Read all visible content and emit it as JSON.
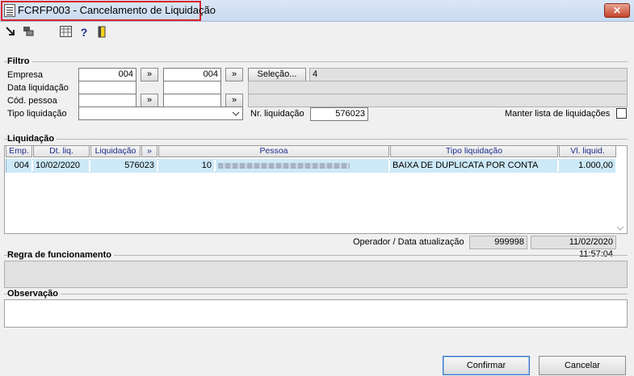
{
  "window": {
    "title": "FCRFP003 - Cancelamento de Liquidação",
    "close_glyph": "✕"
  },
  "toolbar": {
    "icons": [
      "arrow-icon",
      "layers-icon",
      "grid-icon",
      "help-icon",
      "exit-icon"
    ]
  },
  "filtro": {
    "section": "Filtro",
    "empresa_label": "Empresa",
    "empresa_from": "004",
    "empresa_to": "004",
    "selecao_label": "Seleção...",
    "selecao_value": "4",
    "data_label": "Data liquidação",
    "cod_label": "Cód. pessoa",
    "tipo_label": "Tipo liquidação",
    "nr_label": "Nr. liquidação",
    "nr_value": "576023",
    "manter_label": "Manter lista de liquidações",
    "range_glyph": "»"
  },
  "liquidacao": {
    "section": "Liquidação",
    "columns": {
      "emp": "Emp.",
      "dt": "Dt. liq.",
      "liq": "Liquidação",
      "pessoa": "Pessoa",
      "tipo": "Tipo liquidação",
      "vl": "Vl. liquid."
    },
    "rows": [
      {
        "emp": "004",
        "dt": "10/02/2020",
        "liq": "576023",
        "pessoa_cod": "10",
        "tipo": "BAIXA DE DUPLICATA POR CONTA",
        "vl": "1.000,00"
      }
    ],
    "operador_label": "Operador / Data atualização",
    "operador_value": "999998",
    "data_value": "11/02/2020 11:57:04"
  },
  "regra": {
    "section": "Regra de funcionamento"
  },
  "observacao": {
    "section": "Observação"
  },
  "actions": {
    "confirmar": "Confirmar",
    "cancelar": "Cancelar"
  }
}
